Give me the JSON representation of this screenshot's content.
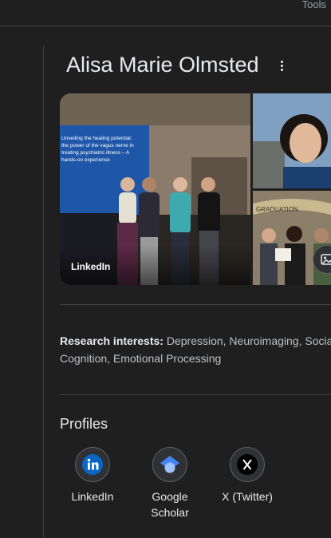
{
  "header": {
    "tools_label": "Tools"
  },
  "entity": {
    "name": "Alisa Marie Olmsted"
  },
  "photos": {
    "main_source": "LinkedIn",
    "slide_text": [
      "Unveiling the healing potential:",
      "the power of the vagus nerve in",
      "treating psychiatric illness – A",
      "hands-on experience"
    ],
    "banner_text": "GRADUATION"
  },
  "research": {
    "label": "Research interests:",
    "text": "Depression, Neuroimaging, Social Cognition, Emotional Processing"
  },
  "profiles": {
    "heading": "Profiles",
    "items": [
      {
        "label": "LinkedIn",
        "icon": "linkedin-icon",
        "color": "#0a66c2"
      },
      {
        "label": "Google Scholar",
        "icon": "google-scholar-icon",
        "color": "#4285f4"
      },
      {
        "label": "X (Twitter)",
        "icon": "x-twitter-icon",
        "color": "#000000"
      }
    ]
  }
}
